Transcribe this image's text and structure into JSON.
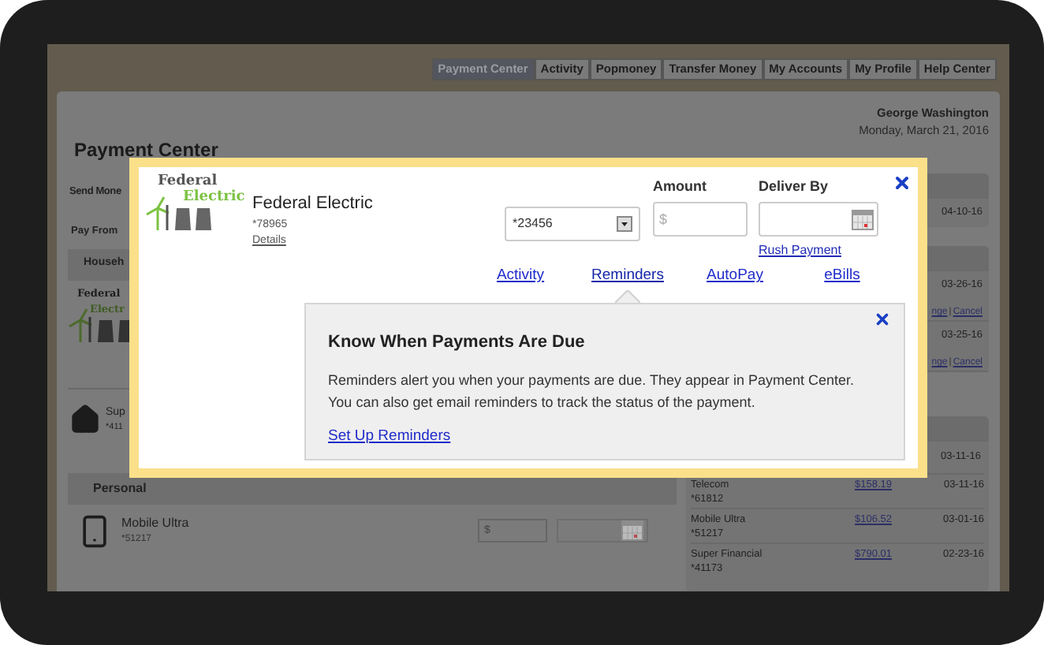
{
  "nav_tabs": [
    {
      "label": "Payment Center",
      "selected": true
    },
    {
      "label": "Activity",
      "selected": false
    },
    {
      "label": "Popmoney",
      "selected": false
    },
    {
      "label": "Transfer Money",
      "selected": false
    },
    {
      "label": "My Accounts",
      "selected": false
    },
    {
      "label": "My Profile",
      "selected": false
    },
    {
      "label": "Help Center",
      "selected": false
    }
  ],
  "user": {
    "name": "George Washington",
    "date": "Monday, March 21, 2016"
  },
  "page_title": "Payment Center",
  "left": {
    "send_money": "Send Mone",
    "pay_from": "Pay From",
    "household_header": "Househ",
    "household_logo": {
      "line1": "Federal",
      "line2": "Electr"
    },
    "household_payee": {
      "name": "Sup",
      "account": "*411"
    },
    "personal_header": "Personal",
    "personal_payee": {
      "name": "Mobile Ultra",
      "account": "*51217",
      "amount_placeholder": "$"
    }
  },
  "right": {
    "scheduled": [
      {
        "date": "04-10-16"
      }
    ],
    "pending": [
      {
        "date": "03-26-16",
        "change_link": "nge",
        "separator": "|",
        "cancel_link": "Cancel"
      },
      {
        "date": "03-25-16",
        "change_link": "nge",
        "separator": "|",
        "cancel_link": "Cancel"
      }
    ],
    "history_top_date": "03-11-16",
    "history": [
      {
        "name": "Telecom",
        "account": "*61812",
        "amount": "$158.19",
        "date": "03-11-16"
      },
      {
        "name": "Mobile Ultra",
        "account": "*51217",
        "amount": "$106.52",
        "date": "03-01-16"
      },
      {
        "name": "Super Financial",
        "account": "*41173",
        "amount": "$790.01",
        "date": "02-23-16"
      }
    ]
  },
  "modal": {
    "logo": {
      "line1": "Federal",
      "line2": "Electric"
    },
    "payee_name": "Federal Electric",
    "payee_account": "*78965",
    "details_link": "Details",
    "pay_from_value": "*23456",
    "amount_label": "Amount",
    "amount_placeholder": "$",
    "deliver_by_label": "Deliver By",
    "rush_link": "Rush Payment",
    "links": [
      {
        "label": "Activity",
        "selected": false
      },
      {
        "label": "Reminders",
        "selected": true
      },
      {
        "label": "AutoPay",
        "selected": false
      },
      {
        "label": "eBills",
        "selected": false
      }
    ],
    "popover": {
      "title": "Know When Payments Are Due",
      "body": "Reminders alert you when your payments are due. They appear in Payment Center. You can also get email reminders to track the status of the payment.",
      "link": "Set Up Reminders"
    }
  }
}
